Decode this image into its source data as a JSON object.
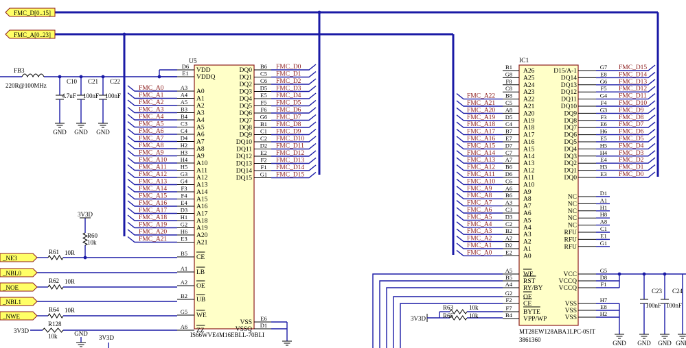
{
  "ports": {
    "fmc_d": "FMC_D[0..15]",
    "fmc_a": "FMC_A[0..23]",
    "left": [
      "_NE3",
      "_NBL0",
      "_NOE",
      "_NBL1",
      "_NWE"
    ]
  },
  "power": {
    "ferrite_ref": "FB3",
    "ferrite_val": "220R@100MHz",
    "caps": [
      {
        "ref": "C10",
        "val": "4.7uF"
      },
      {
        "ref": "C21",
        "val": "100nF"
      },
      {
        "ref": "C22",
        "val": "100nF"
      }
    ],
    "gnd": "GND",
    "rail": "3V3D"
  },
  "resistors": [
    {
      "ref": "R60",
      "val": "10k"
    },
    {
      "ref": "R61",
      "val": "10R"
    },
    {
      "ref": "R62",
      "val": "10R"
    },
    {
      "ref": "R64",
      "val": "10R"
    },
    {
      "ref": "R128",
      "val": "10k"
    },
    {
      "ref": "R63",
      "val": "10k"
    },
    {
      "ref": "R65",
      "val": "10k"
    }
  ],
  "u5": {
    "ref": "U5",
    "part": "IS66WVE4M16EBLL-70BLI",
    "power_pins": [
      {
        "num": "D6",
        "name": "VDD"
      },
      {
        "num": "E1",
        "name": "VDDQ"
      }
    ],
    "addr_pins": [
      {
        "net": "FMC_A0",
        "num": "A3",
        "name": "A0"
      },
      {
        "net": "FMC_A1",
        "num": "A4",
        "name": "A1"
      },
      {
        "net": "FMC_A2",
        "num": "A5",
        "name": "A2"
      },
      {
        "net": "FMC_A3",
        "num": "B3",
        "name": "A3"
      },
      {
        "net": "FMC_A4",
        "num": "B4",
        "name": "A4"
      },
      {
        "net": "FMC_A5",
        "num": "C3",
        "name": "A5"
      },
      {
        "net": "FMC_A6",
        "num": "C4",
        "name": "A6"
      },
      {
        "net": "FMC_A7",
        "num": "D4",
        "name": "A7"
      },
      {
        "net": "FMC_A8",
        "num": "H2",
        "name": "A8"
      },
      {
        "net": "FMC_A9",
        "num": "H3",
        "name": "A9"
      },
      {
        "net": "FMC_A10",
        "num": "H4",
        "name": "A10"
      },
      {
        "net": "FMC_A11",
        "num": "H5",
        "name": "A11"
      },
      {
        "net": "FMC_A12",
        "num": "G3",
        "name": "A12"
      },
      {
        "net": "FMC_A13",
        "num": "G4",
        "name": "A13"
      },
      {
        "net": "FMC_A14",
        "num": "F3",
        "name": "A14"
      },
      {
        "net": "FMC_A15",
        "num": "F4",
        "name": "A15"
      },
      {
        "net": "FMC_A16",
        "num": "E4",
        "name": "A16"
      },
      {
        "net": "FMC_A17",
        "num": "D3",
        "name": "A17"
      },
      {
        "net": "FMC_A18",
        "num": "H1",
        "name": "A18"
      },
      {
        "net": "FMC_A19",
        "num": "G2",
        "name": "A19"
      },
      {
        "net": "FMC_A20",
        "num": "H6",
        "name": "A20"
      },
      {
        "net": "FMC_A21",
        "num": "E3",
        "name": "A21"
      }
    ],
    "data_pins": [
      {
        "num": "B6",
        "name": "DQ0",
        "net": "FMC_D0"
      },
      {
        "num": "C5",
        "name": "DQ1",
        "net": "FMC_D1"
      },
      {
        "num": "C6",
        "name": "DQ2",
        "net": "FMC_D2"
      },
      {
        "num": "D5",
        "name": "DQ3",
        "net": "FMC_D3"
      },
      {
        "num": "E5",
        "name": "DQ4",
        "net": "FMC_D4"
      },
      {
        "num": "F5",
        "name": "DQ5",
        "net": "FMC_D5"
      },
      {
        "num": "F6",
        "name": "DQ6",
        "net": "FMC_D6"
      },
      {
        "num": "G6",
        "name": "DQ7",
        "net": "FMC_D7"
      },
      {
        "num": "B1",
        "name": "DQ8",
        "net": "FMC_D8"
      },
      {
        "num": "C1",
        "name": "DQ9",
        "net": "FMC_D9"
      },
      {
        "num": "C2",
        "name": "DQ10",
        "net": "FMC_D10"
      },
      {
        "num": "D2",
        "name": "DQ11",
        "net": "FMC_D11"
      },
      {
        "num": "E2",
        "name": "DQ12",
        "net": "FMC_D12"
      },
      {
        "num": "F2",
        "name": "DQ13",
        "net": "FMC_D13"
      },
      {
        "num": "F1",
        "name": "DQ14",
        "net": "FMC_D14"
      },
      {
        "num": "G1",
        "name": "DQ15",
        "net": "FMC_D15"
      }
    ],
    "ctrl_pins": [
      {
        "num": "B5",
        "name": "CE"
      },
      {
        "num": "A1",
        "name": "LB"
      },
      {
        "num": "A2",
        "name": "OE"
      },
      {
        "num": "B2",
        "name": "UB"
      },
      {
        "num": "G5",
        "name": "WE"
      },
      {
        "num": "A6",
        "name": "ZZ"
      }
    ],
    "gnd_pins": [
      {
        "num": "E6",
        "name": "VSS"
      },
      {
        "num": "D1",
        "name": "VSSQ"
      }
    ]
  },
  "ic1": {
    "ref": "IC1",
    "part": "MT28EW128ABA1LPC-0SIT",
    "part2": "3861360",
    "addr_pins": [
      {
        "num": "B1",
        "name": "A26",
        "net": ""
      },
      {
        "num": "G8",
        "name": "A25",
        "net": ""
      },
      {
        "num": "F8",
        "name": "A24",
        "net": ""
      },
      {
        "num": "C8",
        "name": "A23",
        "net": ""
      },
      {
        "num": "B8",
        "name": "A22",
        "net": "FMC_A22"
      },
      {
        "num": "C5",
        "name": "A21",
        "net": "FMC_A21"
      },
      {
        "num": "A8",
        "name": "A20",
        "net": "FMC_A20"
      },
      {
        "num": "D5",
        "name": "A19",
        "net": "FMC_A19"
      },
      {
        "num": "C4",
        "name": "A18",
        "net": "FMC_A18"
      },
      {
        "num": "B7",
        "name": "A17",
        "net": "FMC_A17"
      },
      {
        "num": "E7",
        "name": "A16",
        "net": "FMC_A16"
      },
      {
        "num": "D7",
        "name": "A15",
        "net": "FMC_A15"
      },
      {
        "num": "C7",
        "name": "A14",
        "net": "FMC_A14"
      },
      {
        "num": "A7",
        "name": "A13",
        "net": "FMC_A13"
      },
      {
        "num": "B6",
        "name": "A12",
        "net": "FMC_A12"
      },
      {
        "num": "D6",
        "name": "A11",
        "net": "FMC_A11"
      },
      {
        "num": "C6",
        "name": "A10",
        "net": "FMC_A10"
      },
      {
        "num": "A6",
        "name": "A9",
        "net": "FMC_A9"
      },
      {
        "num": "B6",
        "name": "A8",
        "net": "FMC_A8"
      },
      {
        "num": "A3",
        "name": "A7",
        "net": "FMC_A7"
      },
      {
        "num": "C3",
        "name": "A6",
        "net": "FMC_A6"
      },
      {
        "num": "D3",
        "name": "A5",
        "net": "FMC_A5"
      },
      {
        "num": "C2",
        "name": "A4",
        "net": "FMC_A4"
      },
      {
        "num": "B2",
        "name": "A3",
        "net": "FMC_A3"
      },
      {
        "num": "A2",
        "name": "A2",
        "net": "FMC_A2"
      },
      {
        "num": "D2",
        "name": "A1",
        "net": "FMC_A1"
      },
      {
        "num": "E2",
        "name": "A0",
        "net": "FMC_A0"
      }
    ],
    "data_pins": [
      {
        "num": "G7",
        "name": "D15/A-1",
        "net": "FMC_D15"
      },
      {
        "num": "E8",
        "name": "DQ14",
        "net": "FMC_D14"
      },
      {
        "num": "G6",
        "name": "DQ13",
        "net": "FMC_D13"
      },
      {
        "num": "F5",
        "name": "DQ12",
        "net": "FMC_D12"
      },
      {
        "num": "G4",
        "name": "DQ11",
        "net": "FMC_D11"
      },
      {
        "num": "F4",
        "name": "DQ10",
        "net": "FMC_D10"
      },
      {
        "num": "G3",
        "name": "DQ9",
        "net": "FMC_D9"
      },
      {
        "num": "F3",
        "name": "DQ8",
        "net": "FMC_D8"
      },
      {
        "num": "E6",
        "name": "DQ7",
        "net": "FMC_D7"
      },
      {
        "num": "H6",
        "name": "DQ6",
        "net": "FMC_D6"
      },
      {
        "num": "E5",
        "name": "DQ5",
        "net": "FMC_D5"
      },
      {
        "num": "H5",
        "name": "DQ4",
        "net": "FMC_D4"
      },
      {
        "num": "H4",
        "name": "DQ3",
        "net": "FMC_D3"
      },
      {
        "num": "E4",
        "name": "DQ2",
        "net": "FMC_D2"
      },
      {
        "num": "H3",
        "name": "DQ1",
        "net": "FMC_D1"
      },
      {
        "num": "E3",
        "name": "DQ0",
        "net": "FMC_D0"
      }
    ],
    "nc_pins": [
      {
        "num": "D1",
        "name": "NC"
      },
      {
        "num": "A1",
        "name": "NC"
      },
      {
        "num": "H1",
        "name": "NC"
      },
      {
        "num": "H8",
        "name": "NC"
      },
      {
        "num": "A8",
        "name": "NC"
      },
      {
        "num": "C1",
        "name": "RFU"
      },
      {
        "num": "E1",
        "name": "RFU"
      },
      {
        "num": "G1",
        "name": "RFU"
      }
    ],
    "ctrl_pins": [
      {
        "num": "A5",
        "name": "WE"
      },
      {
        "num": "B5",
        "name": "RST"
      },
      {
        "num": "A4",
        "name": "RY/BY"
      },
      {
        "num": "G2",
        "name": "OE"
      },
      {
        "num": "F2",
        "name": "CE"
      },
      {
        "num": "F7",
        "name": "BYTE"
      },
      {
        "num": "B4",
        "name": "VPP/WP"
      }
    ],
    "pwr_pins": [
      {
        "num": "G5",
        "name": "VCC"
      },
      {
        "num": "D8",
        "name": "VCCQ"
      },
      {
        "num": "F1",
        "name": "VCCQ"
      },
      {
        "num": "H7",
        "name": "VSS"
      },
      {
        "num": "E8",
        "name": "VSS"
      },
      {
        "num": "H2",
        "name": "VSS"
      }
    ]
  },
  "right_caps": [
    {
      "ref": "C23",
      "val": "100nF"
    },
    {
      "ref": "C24",
      "val": "100nF"
    }
  ]
}
